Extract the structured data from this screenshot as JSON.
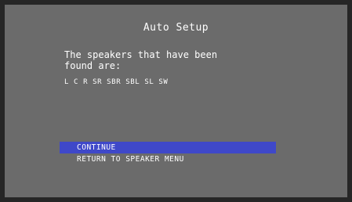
{
  "screen": {
    "title": "Auto Setup",
    "message_lines": [
      "The speakers that have been",
      "found are:"
    ],
    "speakers": "L C R SR SBR SBL SL SW",
    "menu": [
      {
        "label": "CONTINUE",
        "selected": true
      },
      {
        "label": "RETURN TO SPEAKER MENU",
        "selected": false
      }
    ]
  }
}
